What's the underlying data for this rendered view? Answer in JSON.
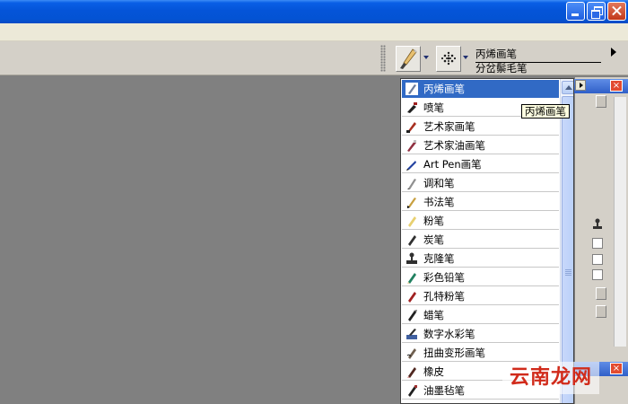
{
  "propbar": {
    "category_name": "丙烯画笔",
    "variant_name": "分岔鬃毛笔"
  },
  "brush_list": {
    "items": [
      {
        "label": "丙烯画笔",
        "icon": "acrylic-brush-icon",
        "selected": true
      },
      {
        "label": "喷笔",
        "icon": "airbrush-icon"
      },
      {
        "label": "艺术家画笔",
        "icon": "artists-brush-icon"
      },
      {
        "label": "艺术家油画笔",
        "icon": "artists-oils-icon"
      },
      {
        "label": "Art Pen画笔",
        "icon": "art-pen-icon"
      },
      {
        "label": "调和笔",
        "icon": "blender-icon"
      },
      {
        "label": "书法笔",
        "icon": "calligraphy-icon"
      },
      {
        "label": "粉笔",
        "icon": "chalk-icon"
      },
      {
        "label": "炭笔",
        "icon": "charcoal-icon"
      },
      {
        "label": "克隆笔",
        "icon": "cloner-icon"
      },
      {
        "label": "彩色铅笔",
        "icon": "colored-pencil-icon"
      },
      {
        "label": "孔特粉笔",
        "icon": "conte-icon"
      },
      {
        "label": "蜡笔",
        "icon": "crayon-icon"
      },
      {
        "label": "数字水彩笔",
        "icon": "digital-watercolor-icon"
      },
      {
        "label": "扭曲变形画笔",
        "icon": "distortion-icon"
      },
      {
        "label": "橡皮",
        "icon": "eraser-icon"
      },
      {
        "label": "油墨毡笔",
        "icon": "felt-pen-icon"
      }
    ]
  },
  "tooltip": {
    "text": "丙烯画笔"
  },
  "watermark": {
    "text": "云南龙网"
  },
  "colors": {
    "selection": "#316ac5",
    "titlebar": "#0454d8",
    "canvas": "#808080",
    "watermark": "#d12b1b"
  }
}
